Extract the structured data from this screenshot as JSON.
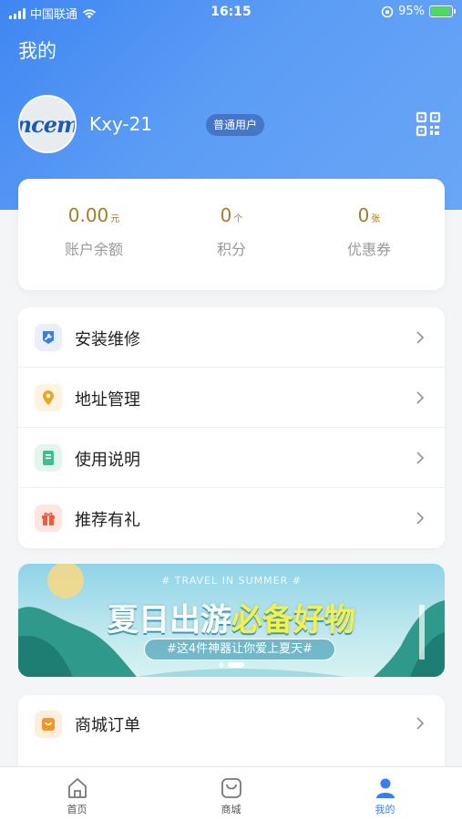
{
  "status_bar": {
    "carrier": "中国联通",
    "time": "16:15",
    "battery": "95%",
    "battery_level": 0.95
  },
  "header": {
    "title": "我的"
  },
  "user": {
    "avatar_text": "ncem",
    "name": "Kxy-21",
    "badge": "普通用户"
  },
  "stats": [
    {
      "value": "0.00",
      "unit": "元",
      "label": "账户余额"
    },
    {
      "value": "0",
      "unit": "个",
      "label": "积分"
    },
    {
      "value": "0",
      "unit": "张",
      "label": "优惠券"
    }
  ],
  "menu": [
    {
      "label": "安装维修",
      "icon": "wrench-icon",
      "color": "#3a7df0",
      "bg": "#e8f0fd"
    },
    {
      "label": "地址管理",
      "icon": "location-pin-icon",
      "color": "#e8a72a",
      "bg": "#fdf3df"
    },
    {
      "label": "使用说明",
      "icon": "book-icon",
      "color": "#3cc08f",
      "bg": "#e2f6ee"
    },
    {
      "label": "推荐有礼",
      "icon": "gift-icon",
      "color": "#ef5a3c",
      "bg": "#fde6e0"
    }
  ],
  "banner": {
    "subtitle": "# TRAVEL IN SUMMER #",
    "title_main": "夏日出游",
    "title_highlight": "必备好物",
    "pill": "#这4件神器让你爱上夏天#",
    "slides": 2,
    "active_slide": 1
  },
  "menu2": [
    {
      "label": "商城订单",
      "icon": "order-bag-icon",
      "color": "#f2962a",
      "bg": "#fdefdc"
    }
  ],
  "tabbar": [
    {
      "label": "首页",
      "icon": "home-icon",
      "active": false
    },
    {
      "label": "商城",
      "icon": "shop-bag-icon",
      "active": false
    },
    {
      "label": "我的",
      "icon": "user-icon",
      "active": true
    }
  ],
  "colors": {
    "primary": "#3a7df0",
    "header_gradient_start": "#3f86f2",
    "value_gold": "#a67c2a"
  }
}
